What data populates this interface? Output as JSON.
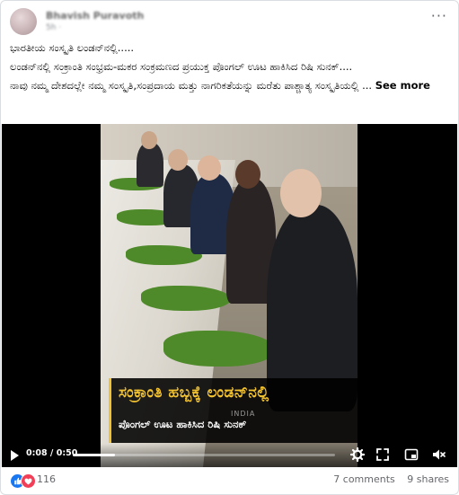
{
  "post": {
    "author": "Bhavish Puravoth",
    "meta": "5h · ",
    "lines": [
      "ಭಾರತೀಯ ಸಂಸ್ಕೃತಿ ಲಂಡನ್‌ನಲ್ಲಿ.....",
      "ಲಂಡನ್‌ನಲ್ಲಿ ಸಂಕ್ರಾಂತಿ ಸಂಭ್ರಮ-ಮಕರ ಸಂಕ್ರಮಣದ ಪ್ರಯುಕ್ತ ಪೊಂಗಲ್ ಊಟ ಹಾಕಿಸಿದ ರಿಷಿ ಸುನಕ್....",
      "ನಾವು ನಮ್ಮ ದೇಶದಲ್ಲೇ ನಮ್ಮ ಸಂಸ್ಕೃತಿ,ಸಂಪ್ರದಾಯ ಮತ್ತು ನಾಗರಿಕತೆಯನ್ನು ಮರೆತು ಪಾಶ್ಚಾತ್ಯ ಸಂಸ್ಕೃತಿಯಲ್ಲಿ ..."
    ],
    "see_more": "See more"
  },
  "video": {
    "caption_line1": "ಸಂಕ್ರಾಂತಿ ಹಬ್ಬಕ್ಕೆ ಲಂಡನ್‌ನಲ್ಲಿ",
    "caption_line2": "ಪೊಂಗಲ್ ಊಟ ಹಾಕಿಸಿದ ರಿಷಿ ಸುನಕ್",
    "watermark": "INDIA",
    "time": "0:08 / 0:50",
    "progress": 0.16
  },
  "footer": {
    "reaction_count": "116",
    "comments": "7 comments",
    "shares": "9 shares"
  },
  "colors": {
    "caption_accent": "#f2c230",
    "like": "#1877f2",
    "love": "#f33e58"
  }
}
